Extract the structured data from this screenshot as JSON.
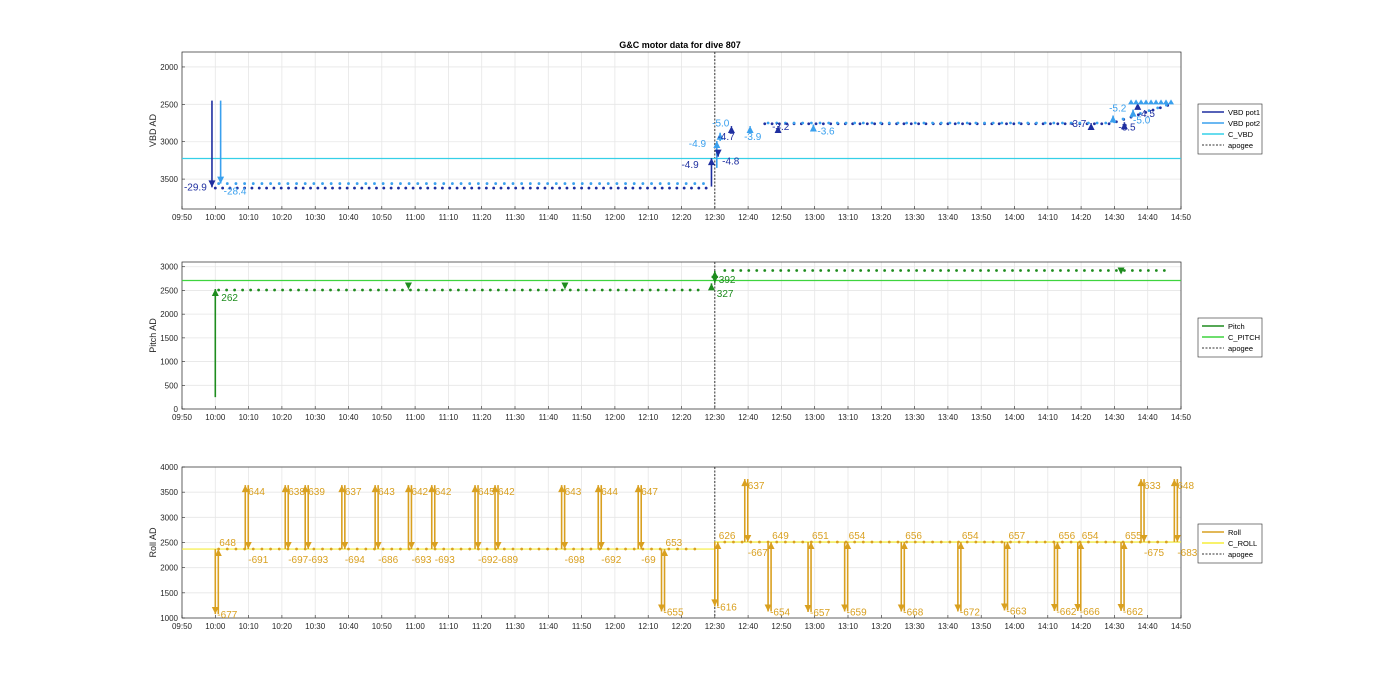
{
  "chart_data": [
    {
      "type": "line",
      "title": "G&C motor data for dive 807",
      "ylabel": "VBD AD",
      "xlim": [
        "09:50",
        "14:50"
      ],
      "ylim": [
        1800,
        3900
      ],
      "y_reversed": true,
      "grid": true,
      "legend_placement": "right",
      "yticks": [
        2000,
        2500,
        3000,
        3500
      ],
      "xtick_labels": [
        "09:50",
        "10:00",
        "10:10",
        "10:20",
        "10:30",
        "10:40",
        "10:50",
        "11:00",
        "11:10",
        "11:20",
        "11:30",
        "11:40",
        "11:50",
        "12:00",
        "12:10",
        "12:20",
        "12:30",
        "12:40",
        "12:50",
        "13:00",
        "13:10",
        "13:20",
        "13:30",
        "13:40",
        "13:50",
        "14:00",
        "14:10",
        "14:20",
        "14:30",
        "14:40",
        "14:50"
      ],
      "apogee": "12:30",
      "series": [
        {
          "name": "VBD pot1",
          "color": "#1f2fa0",
          "x": [
            "09:50",
            "09:59",
            "09:59",
            "12:29",
            "12:29",
            "14:50"
          ],
          "y": [
            3620,
            3620,
            2450,
            2450,
            3620,
            3620
          ]
        },
        {
          "name": "VBD pot2",
          "color": "#3aa0ee",
          "x": [
            "09:50",
            "10:01",
            "10:01",
            "12:30",
            "12:30",
            "14:50"
          ],
          "y": [
            3560,
            3560,
            2450,
            2450,
            3560,
            3560
          ]
        },
        {
          "name": "C_VBD",
          "color": "#35d0e8",
          "x": [
            "09:50",
            "14:50"
          ],
          "y": [
            3225,
            3225
          ]
        },
        {
          "name": "apogee",
          "color": "#333333"
        }
      ],
      "moves": [
        {
          "t": "09:59",
          "from": 2450,
          "to": 3610,
          "label": "-29.9",
          "lab_dx": -28,
          "lab_dy": 3
        },
        {
          "t": "10:01",
          "from": 2450,
          "to": 3560,
          "label": "-28.4",
          "lab_dx": 3,
          "lab_dy": 11
        },
        {
          "t": "12:29",
          "from": 3600,
          "to": 3220,
          "label": "-4.9",
          "lab_dx": -30,
          "lab_dy": 10
        },
        {
          "t": "12:30",
          "from": 3350,
          "to": 2990,
          "label": "-4.9",
          "lab_dx": -28,
          "lab_dy": 6
        },
        {
          "t": "12:31",
          "from": 3150,
          "to": 3200,
          "label": "-4.8",
          "lab_dx": 4,
          "lab_dy": 8
        },
        {
          "t": "12:31",
          "from": 2990,
          "to": 2880,
          "label": "-5.0",
          "lab_dx": -8,
          "lab_dy": -6
        },
        {
          "t": "12:35",
          "from": 2800,
          "to": 2790,
          "label": "-4.7",
          "lab_dx": -14,
          "lab_dy": 14
        },
        {
          "t": "12:40",
          "from": 2800,
          "to": 2790,
          "label": "-3.9",
          "lab_dx": -6,
          "lab_dy": 14
        },
        {
          "t": "12:49",
          "from": 2800,
          "to": 2790,
          "label": "-3.2",
          "lab_dx": -6,
          "lab_dy": 4
        },
        {
          "t": "12:59",
          "from": 2790,
          "to": 2770,
          "label": "-3.6",
          "lab_dx": 4,
          "lab_dy": 10
        },
        {
          "t": "14:23",
          "from": 2760,
          "to": 2750,
          "label": "-3.7",
          "lab_dx": -22,
          "lab_dy": 4
        },
        {
          "t": "14:29",
          "from": 2720,
          "to": 2650,
          "label": "-5.2",
          "lab_dx": -4,
          "lab_dy": -4
        },
        {
          "t": "14:33",
          "from": 2750,
          "to": 2740,
          "label": "-3.5",
          "lab_dx": -6,
          "lab_dy": 8
        },
        {
          "t": "14:35",
          "from": 2650,
          "to": 2570,
          "label": "-5.0",
          "lab_dx": 0,
          "lab_dy": 14
        },
        {
          "t": "14:37",
          "from": 2550,
          "to": 2480,
          "label": "-4.5",
          "lab_dx": 0,
          "lab_dy": 14
        }
      ],
      "dots_pot1": {
        "start": "10:00",
        "end": "12:28",
        "y": 3620,
        "after_start": "12:45",
        "after_end": "14:47",
        "after_y": 2760,
        "end_y": 2500
      },
      "dots_pot2": {
        "start": "10:01",
        "end": "12:28",
        "y": 3560,
        "after_start": "12:46",
        "after_end": "14:47",
        "after_y": 2750,
        "end_y": 2490
      }
    },
    {
      "type": "line",
      "title": "",
      "ylabel": "Pitch AD",
      "xlim": [
        "09:50",
        "14:50"
      ],
      "ylim": [
        0,
        3100
      ],
      "grid": true,
      "legend_placement": "right",
      "yticks": [
        0,
        500,
        1000,
        1500,
        2000,
        2500,
        3000
      ],
      "apogee": "12:30",
      "series": [
        {
          "name": "Pitch",
          "color": "#1e8c1e",
          "x": [
            "10:00",
            "10:00"
          ],
          "y": [
            250,
            2530
          ]
        },
        {
          "name": "C_PITCH",
          "color": "#3ed43e",
          "x": [
            "09:50",
            "14:50"
          ],
          "y": [
            2710,
            2710
          ]
        },
        {
          "name": "apogee",
          "color": "#333333"
        }
      ],
      "moves": [
        {
          "t": "10:00",
          "from": 250,
          "to": 2530,
          "label": "262",
          "lab_dx": 6,
          "lab_dy": 12
        },
        {
          "t": "12:29",
          "from": 2520,
          "to": 2650,
          "label": "",
          "lab_dx": 0,
          "lab_dy": 0
        },
        {
          "t": "12:30",
          "from": 2660,
          "to": 2910,
          "label": "392",
          "lab_dx": 4,
          "lab_dy": 12
        },
        {
          "t": "12:30",
          "from": 2660,
          "to": 2660,
          "label": "327",
          "lab_dx": 2,
          "lab_dy": 14
        },
        {
          "t": "10:58",
          "from": 2530,
          "to": 2520,
          "label": "",
          "lab_dx": 0,
          "lab_dy": 0
        },
        {
          "t": "11:45",
          "from": 2530,
          "to": 2520,
          "label": "",
          "lab_dx": 0,
          "lab_dy": 0
        }
      ],
      "down_markers": [
        "14:32"
      ],
      "dots": {
        "start": "10:01",
        "end": "12:25",
        "y": 2510,
        "after_start": "12:33",
        "after_end": "14:47",
        "after_y": 2920
      }
    },
    {
      "type": "line",
      "title": "",
      "ylabel": "Roll AD",
      "xlim": [
        "09:50",
        "14:50"
      ],
      "ylim": [
        1000,
        4000
      ],
      "grid": true,
      "legend_placement": "right",
      "yticks": [
        1000,
        1500,
        2000,
        2500,
        3000,
        3500,
        4000
      ],
      "apogee": "12:30",
      "series": [
        {
          "name": "Roll",
          "color": "#d9a020"
        },
        {
          "name": "C_ROLL",
          "color": "#f5ee3a",
          "x": [
            "09:50",
            "12:30",
            "12:30",
            "14:50"
          ],
          "y": [
            2370,
            2370,
            2510,
            2510
          ]
        },
        {
          "name": "apogee",
          "color": "#333333"
        }
      ],
      "pulses": [
        {
          "t": "10:00",
          "top": 1080,
          "base": 2370,
          "up": "648",
          "down": "-677",
          "flip": true
        },
        {
          "t": "10:09",
          "top": 3640,
          "base": 2370,
          "up": "644",
          "down": "-691"
        },
        {
          "t": "10:21",
          "top": 3640,
          "base": 2370,
          "up": "638",
          "down": "-697"
        },
        {
          "t": "10:27",
          "top": 3640,
          "base": 2370,
          "up": "639",
          "down": "-693"
        },
        {
          "t": "10:38",
          "top": 3640,
          "base": 2370,
          "up": "637",
          "down": "-694"
        },
        {
          "t": "10:48",
          "top": 3640,
          "base": 2370,
          "up": "643",
          "down": "-686"
        },
        {
          "t": "10:58",
          "top": 3640,
          "base": 2370,
          "up": "642",
          "down": "-693"
        },
        {
          "t": "11:05",
          "top": 3640,
          "base": 2370,
          "up": "642",
          "down": "-693"
        },
        {
          "t": "11:18",
          "top": 3640,
          "base": 2370,
          "up": "645",
          "down": "-692-689"
        },
        {
          "t": "11:24",
          "top": 3640,
          "base": 2370,
          "up": "642",
          "down": ""
        },
        {
          "t": "11:44",
          "top": 3640,
          "base": 2370,
          "up": "643",
          "down": "-698"
        },
        {
          "t": "11:55",
          "top": 3640,
          "base": 2370,
          "up": "644",
          "down": "-692"
        },
        {
          "t": "12:07",
          "top": 3640,
          "base": 2370,
          "up": "647",
          "down": "-69"
        },
        {
          "t": "12:14",
          "top": 1130,
          "base": 2370,
          "up": "653",
          "down": "-655",
          "flip": true
        },
        {
          "t": "12:30",
          "top": 1230,
          "base": 2510,
          "up": "626",
          "down": "-616",
          "flip": true
        },
        {
          "t": "12:39",
          "top": 3760,
          "base": 2510,
          "up": "637",
          "down": "-667"
        },
        {
          "t": "12:46",
          "top": 1130,
          "base": 2510,
          "up": "649",
          "down": "-654",
          "flip": true
        },
        {
          "t": "12:58",
          "top": 1120,
          "base": 2510,
          "up": "651",
          "down": "-657",
          "flip": true
        },
        {
          "t": "13:09",
          "top": 1130,
          "base": 2510,
          "up": "654",
          "down": "-659",
          "flip": true
        },
        {
          "t": "13:26",
          "top": 1130,
          "base": 2510,
          "up": "656",
          "down": "-668",
          "flip": true
        },
        {
          "t": "13:43",
          "top": 1130,
          "base": 2510,
          "up": "654",
          "down": "-672",
          "flip": true
        },
        {
          "t": "13:57",
          "top": 1150,
          "base": 2510,
          "up": "657",
          "down": "-663",
          "flip": true
        },
        {
          "t": "14:12",
          "top": 1140,
          "base": 2510,
          "up": "656",
          "down": "-662",
          "flip": true
        },
        {
          "t": "14:19",
          "top": 1140,
          "base": 2510,
          "up": "654",
          "down": "-666",
          "flip": true
        },
        {
          "t": "14:32",
          "top": 1140,
          "base": 2510,
          "up": "655",
          "down": "-662",
          "flip": true
        },
        {
          "t": "14:38",
          "top": 3760,
          "base": 2510,
          "up": "633",
          "down": "-675"
        },
        {
          "t": "14:48",
          "top": 3760,
          "base": 2510,
          "up": "648",
          "down": "-683"
        }
      ]
    }
  ]
}
